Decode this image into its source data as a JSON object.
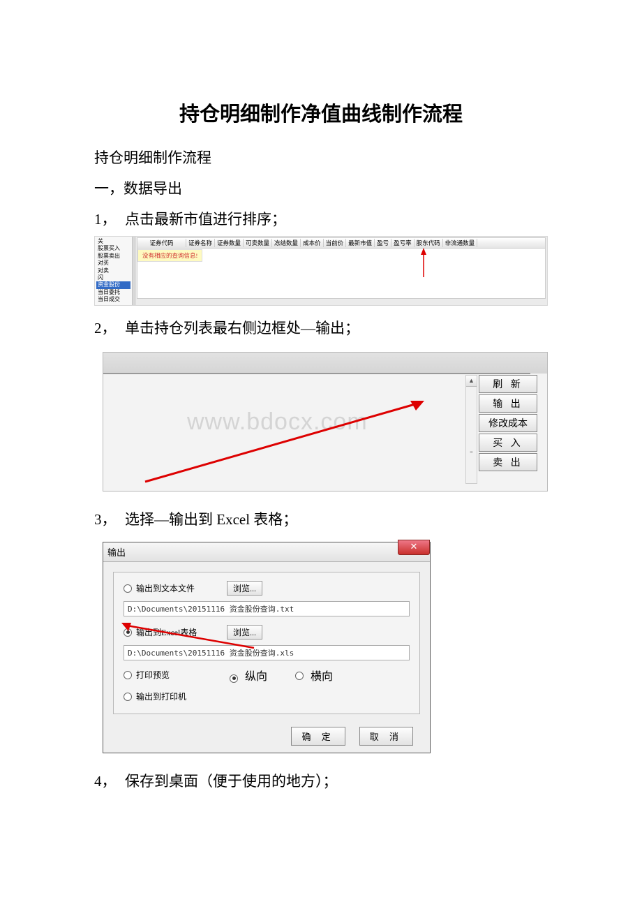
{
  "title": "持仓明细制作净值曲线制作流程",
  "subtitle": "持仓明细制作流程",
  "heading1": "一，数据导出",
  "steps": {
    "s1": {
      "num": "1，",
      "text": "点击最新市值进行排序；"
    },
    "s2": {
      "num": "2，",
      "text": "单击持仓列表最右侧边框处—输出；"
    },
    "s3": {
      "num": "3，",
      "text": "选择—输出到 Excel 表格；"
    },
    "s4": {
      "num": "4，",
      "text": "保存到桌面（便于使用的地方）；"
    }
  },
  "fig1": {
    "sidebar": [
      "关",
      "股票买入",
      "股票卖出",
      "对买",
      "对卖",
      "闪",
      "资金股份",
      "当日委托",
      "当日成交"
    ],
    "selectedSidebar": "资金股份",
    "headers": [
      "证券代码",
      "证券名称",
      "证券数量",
      "可卖数量",
      "冻结数量",
      "成本价",
      "当前价",
      "最新市值",
      "盈亏",
      "盈亏率",
      "股东代码",
      "非流通数量"
    ],
    "emptyMsg": "没有相应的查询信息!"
  },
  "fig2": {
    "buttons": [
      "刷 新",
      "输 出",
      "修改成本",
      "买 入",
      "卖 出"
    ],
    "watermark": "www.bdocx.com"
  },
  "fig3": {
    "dialogTitle": "输出",
    "options": {
      "txt": "输出到文本文件",
      "xls": "输出到Excel表格",
      "preview": "打印预览",
      "printer": "输出到打印机"
    },
    "browse": "浏览...",
    "txtPath": "D:\\Documents\\20151116 资金股份查询.txt",
    "xlsPath": "D:\\Documents\\20151116 资金股份查询.xls",
    "portrait": "纵向",
    "landscape": "横向",
    "ok": "确 定",
    "cancel": "取 消"
  }
}
